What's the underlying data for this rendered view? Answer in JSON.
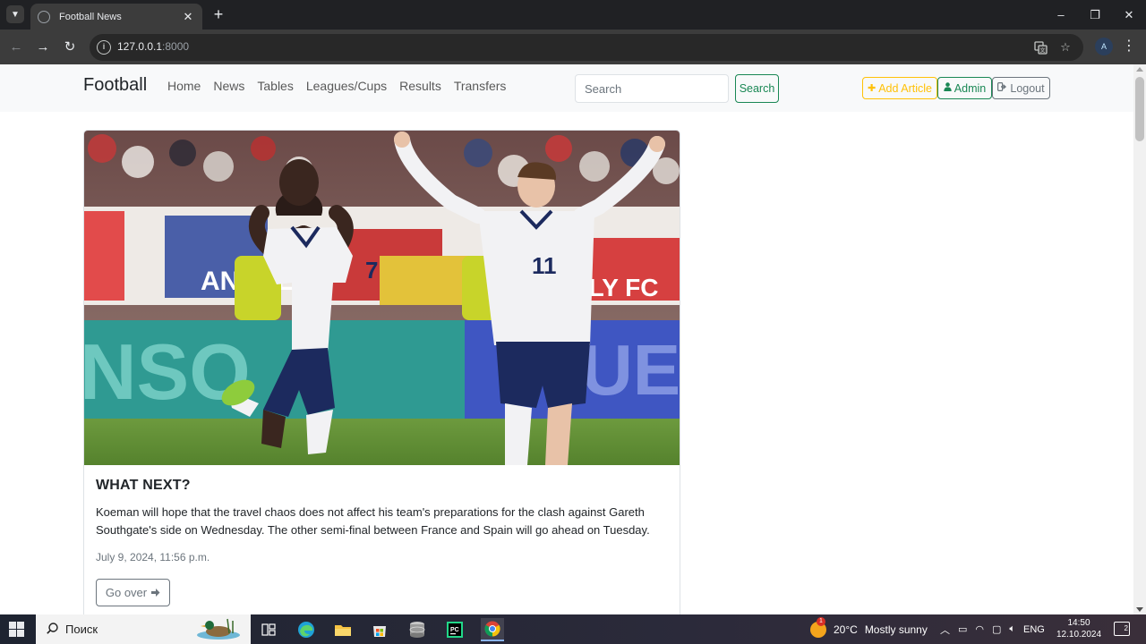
{
  "browser": {
    "tab_title": "Football News",
    "tab_close": "✕",
    "new_tab": "+",
    "url_host": "127.0.0.1",
    "url_port": ":8000",
    "profile_initial": "A",
    "window_controls": {
      "minimize": "–",
      "maximize": "❐",
      "close": "✕"
    }
  },
  "site": {
    "brand": "Football",
    "nav": [
      "Home",
      "News",
      "Tables",
      "Leagues/Cups",
      "Results",
      "Transfers"
    ],
    "search": {
      "placeholder": "Search",
      "button": "Search"
    },
    "actions": {
      "add_article": "Add Article",
      "admin": "Admin",
      "logout": "Logout"
    },
    "colors": {
      "accent_success": "#198754",
      "accent_warning": "#ffc107",
      "secondary": "#6c757d"
    }
  },
  "article": {
    "title": "WHAT NEXT?",
    "text": "Koeman will hope that the travel chaos does not affect his team's preparations for the clash against Gareth Southgate's side on Wednesday. The other semi-final between France and Spain will go ahead on Tuesday.",
    "date": "July 9, 2024, 11:56 p.m.",
    "button": "Go over",
    "image": {
      "player_left_number": "7",
      "player_right_number": "11",
      "board_left": "NSO",
      "board_right": "UE",
      "banner_left": "ANGLE",
      "banner_right": "SLY FC"
    }
  },
  "taskbar": {
    "search_text": "Поиск",
    "weather_badge": "1",
    "weather_temp": "20°C",
    "weather_text": "Mostly sunny",
    "language": "ENG",
    "time": "14:50",
    "date": "12.10.2024",
    "notifications": "2"
  }
}
